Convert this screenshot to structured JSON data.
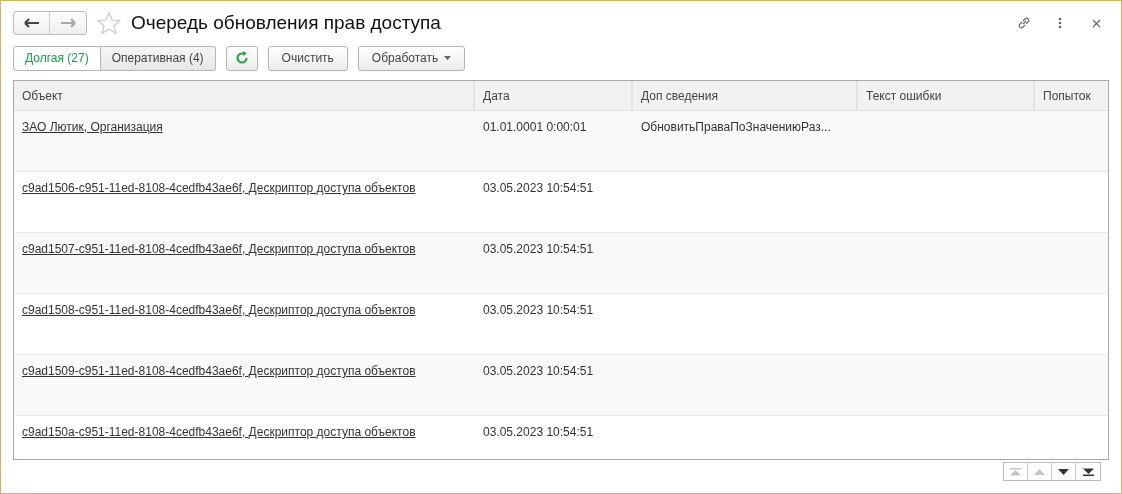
{
  "window": {
    "title": "Очередь обновления прав доступа"
  },
  "nav": [
    {
      "kind": "back",
      "disabled": false
    },
    {
      "kind": "forward",
      "disabled": true
    }
  ],
  "tabs": [
    {
      "label": "Долгая (27)",
      "selected": true
    },
    {
      "label": "Оперативная (4)",
      "selected": false
    }
  ],
  "buttons": [
    {
      "kind": "refresh"
    },
    {
      "kind": "text",
      "label": "Очистить"
    },
    {
      "kind": "menu",
      "label": "Обработать"
    }
  ],
  "table": {
    "columns": [
      "Объект",
      "Дата",
      "Доп сведения",
      "Текст ошибки",
      "Попыток"
    ],
    "rows": [
      {
        "object": "ЗАО Лютик, Организация",
        "date": "01.01.0001 0:00:01",
        "info": "ОбновитьПраваПоЗначениюРаз..."
      },
      {
        "object": "c9ad1506-c951-11ed-8108-4cedfb43ae6f, Дескриптор доступа объектов",
        "date": "03.05.2023 10:54:51"
      },
      {
        "object": "c9ad1507-c951-11ed-8108-4cedfb43ae6f, Дескриптор доступа объектов",
        "date": "03.05.2023 10:54:51"
      },
      {
        "object": "c9ad1508-c951-11ed-8108-4cedfb43ae6f, Дескриптор доступа объектов",
        "date": "03.05.2023 10:54:51"
      },
      {
        "object": "c9ad1509-c951-11ed-8108-4cedfb43ae6f, Дескриптор доступа объектов",
        "date": "03.05.2023 10:54:51"
      },
      {
        "object": "c9ad150a-c951-11ed-8108-4cedfb43ae6f, Дескриптор доступа объектов",
        "date": "03.05.2023 10:54:51"
      }
    ]
  },
  "scroll_buttons": [
    {
      "kind": "first",
      "disabled": true
    },
    {
      "kind": "up",
      "disabled": true
    },
    {
      "kind": "down",
      "disabled": false
    },
    {
      "kind": "last",
      "disabled": false
    }
  ]
}
